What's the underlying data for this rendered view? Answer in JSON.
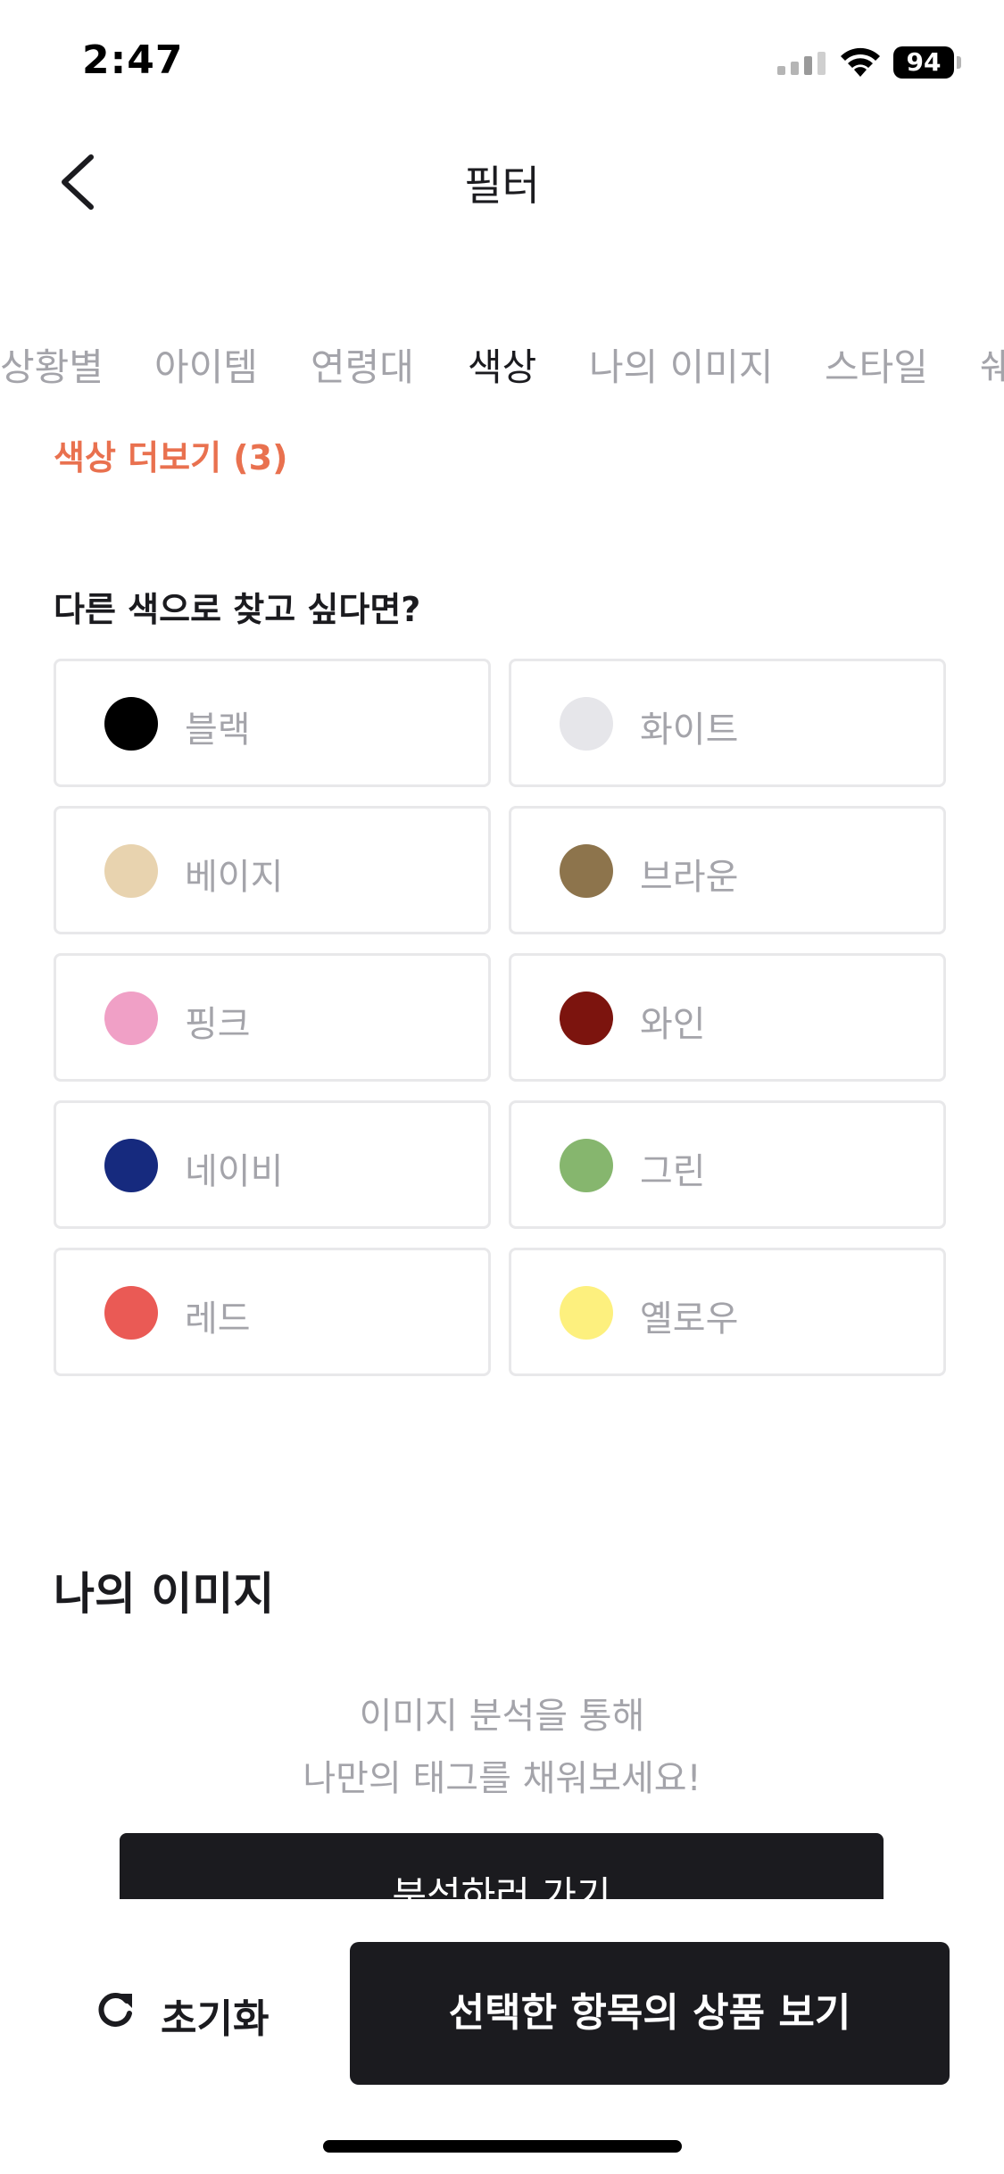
{
  "status_bar": {
    "time": "2:47",
    "battery": "94"
  },
  "header": {
    "title": "필터",
    "back_icon": "chevron-left-icon"
  },
  "tabs": [
    {
      "label": "상황별",
      "active": false
    },
    {
      "label": "아이템",
      "active": false
    },
    {
      "label": "연령대",
      "active": false
    },
    {
      "label": "색상",
      "active": true
    },
    {
      "label": "나의 이미지",
      "active": false
    },
    {
      "label": "스타일",
      "active": false
    },
    {
      "label": "쉐",
      "active": false
    }
  ],
  "color_section": {
    "more_label": "색상 더보기 (3)",
    "question": "다른 색으로 찾고 싶다면?",
    "colors": [
      {
        "label": "블랙",
        "color": "#000000"
      },
      {
        "label": "화이트",
        "color": "#e6e6ea"
      },
      {
        "label": "베이지",
        "color": "#e8d3af"
      },
      {
        "label": "브라운",
        "color": "#8d744c"
      },
      {
        "label": "핑크",
        "color": "#f0a0c6"
      },
      {
        "label": "와인",
        "color": "#7c140e"
      },
      {
        "label": "네이비",
        "color": "#162a7e"
      },
      {
        "label": "그린",
        "color": "#86b66e"
      },
      {
        "label": "레드",
        "color": "#ea5a55"
      },
      {
        "label": "옐로우",
        "color": "#fdf07e"
      }
    ]
  },
  "my_image": {
    "title": "나의 이미지",
    "description_line1": "이미지 분석을 통해",
    "description_line2": "나만의 태그를 채워보세요!",
    "analyze_button": "분석하러 가기"
  },
  "bottom_bar": {
    "reset_label": "초기화",
    "reset_icon": "refresh-icon",
    "show_products_label": "선택한 항목의 상품 보기"
  },
  "colors": {
    "accent": "#e9714f",
    "dark": "#1b1b1f",
    "muted_text": "#a4a4aa",
    "chip_border": "#e8e8ea"
  }
}
